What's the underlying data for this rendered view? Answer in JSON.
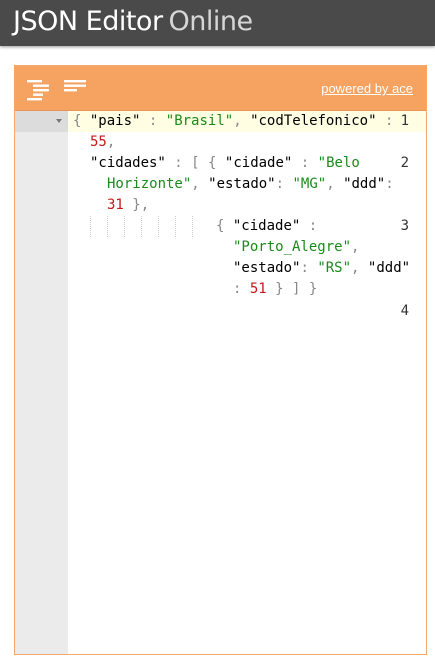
{
  "app": {
    "title_part1": "JSON Editor",
    "title_part2": "Online"
  },
  "menu": {
    "format_icon": "format-indent-icon",
    "compact_icon": "compact-lines-icon",
    "powered_by": "powered by ace"
  },
  "colors": {
    "appbar": "#4a4a4a",
    "menu": "#f6a261",
    "string": "#1a8a1a",
    "number": "#c41a16"
  },
  "editor": {
    "line_numbers": [
      "1",
      "2",
      "3",
      "4"
    ],
    "tokens": {
      "l1_open": "{",
      "l1_key": "\"pais\"",
      "l1_colon": ":",
      "l1_val": "\"Brasil\"",
      "l1_comma": ",",
      "l1_key2": "\"codTelefonico\"",
      "l1_colon2": ":",
      "l1_num": "55",
      "l1_comma2": ",",
      "l2_key": "\"cidades\"",
      "l2_colon": ":",
      "l2_open": "[ {",
      "l2_k1": "\"cidade\"",
      "l2_c1": ":",
      "l2_v1a": "\"Belo",
      "l2_v1b": "Horizonte\"",
      "l2_cm1": ",",
      "l2_k2": "\"estado\"",
      "l2_c2": ":",
      "l2_v2": "\"MG\"",
      "l2_cm2": ",",
      "l2_k3": "\"ddd\"",
      "l2_c3": ":",
      "l2_v3": "31",
      "l2_close": "},",
      "l3_open": "{",
      "l3_k1": "\"cidade\"",
      "l3_c1": ":",
      "l3_v1": "\"Porto_Alegre\"",
      "l3_cm1": ",",
      "l3_k2": "\"estado\"",
      "l3_c2": ":",
      "l3_v2": "\"RS\"",
      "l3_cm2": ",",
      "l3_k3": "\"ddd\"",
      "l3_c3": ":",
      "l3_v3": "51",
      "l3_close": "} ] }"
    }
  }
}
